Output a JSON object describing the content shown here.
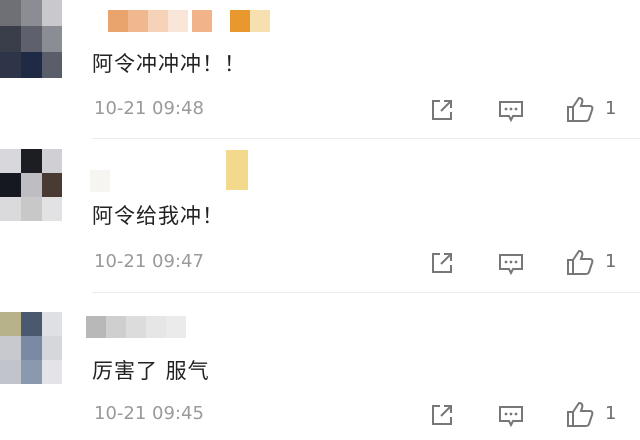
{
  "comments": [
    {
      "text": "阿令冲冲冲！！",
      "time": "10-21 09:48",
      "like_count": "1"
    },
    {
      "text": "阿令给我冲！",
      "time": "10-21 09:47",
      "like_count": "1"
    },
    {
      "text": "厉害了 服气",
      "time": "10-21 09:45",
      "like_count": "1"
    }
  ],
  "icons": {
    "share": "share-icon",
    "reply": "comment-icon",
    "like": "thumbs-up-icon"
  },
  "colors": {
    "text": "#222222",
    "meta": "#9a9a9a",
    "icon": "#777777"
  }
}
